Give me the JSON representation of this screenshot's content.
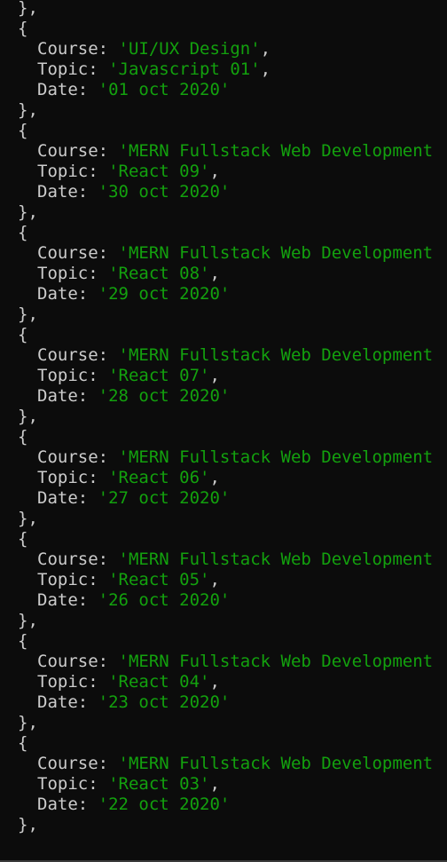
{
  "terminal": {
    "top_fragment": "},",
    "records": [
      {
        "open": "{",
        "course_key": "Course: ",
        "course": "'UI/UX Design'",
        "course_end": ",",
        "topic_key": "Topic: ",
        "topic": "'Javascript 01'",
        "topic_end": ",",
        "date_key": "Date: ",
        "date": "'01 oct 2020'",
        "close": "},"
      },
      {
        "open": "{",
        "course_key": "Course: ",
        "course": "'MERN Fullstack Web Development",
        "course_end": "",
        "topic_key": "Topic: ",
        "topic": "'React 09'",
        "topic_end": ",",
        "date_key": "Date: ",
        "date": "'30 oct 2020'",
        "close": "},"
      },
      {
        "open": "{",
        "course_key": "Course: ",
        "course": "'MERN Fullstack Web Development",
        "course_end": "",
        "topic_key": "Topic: ",
        "topic": "'React 08'",
        "topic_end": ",",
        "date_key": "Date: ",
        "date": "'29 oct 2020'",
        "close": "},"
      },
      {
        "open": "{",
        "course_key": "Course: ",
        "course": "'MERN Fullstack Web Development",
        "course_end": "",
        "topic_key": "Topic: ",
        "topic": "'React 07'",
        "topic_end": ",",
        "date_key": "Date: ",
        "date": "'28 oct 2020'",
        "close": "},"
      },
      {
        "open": "{",
        "course_key": "Course: ",
        "course": "'MERN Fullstack Web Development",
        "course_end": "",
        "topic_key": "Topic: ",
        "topic": "'React 06'",
        "topic_end": ",",
        "date_key": "Date: ",
        "date": "'27 oct 2020'",
        "close": "},"
      },
      {
        "open": "{",
        "course_key": "Course: ",
        "course": "'MERN Fullstack Web Development",
        "course_end": "",
        "topic_key": "Topic: ",
        "topic": "'React 05'",
        "topic_end": ",",
        "date_key": "Date: ",
        "date": "'26 oct 2020'",
        "close": "},"
      },
      {
        "open": "{",
        "course_key": "Course: ",
        "course": "'MERN Fullstack Web Development",
        "course_end": "",
        "topic_key": "Topic: ",
        "topic": "'React 04'",
        "topic_end": ",",
        "date_key": "Date: ",
        "date": "'23 oct 2020'",
        "close": "},"
      },
      {
        "open": "{",
        "course_key": "Course: ",
        "course": "'MERN Fullstack Web Development",
        "course_end": "",
        "topic_key": "Topic: ",
        "topic": "'React 03'",
        "topic_end": ",",
        "date_key": "Date: ",
        "date": "'22 oct 2020'",
        "close": "},"
      }
    ],
    "colors": {
      "background": "#0c0c0c",
      "text": "#cccccc",
      "string": "#13a10e"
    }
  }
}
